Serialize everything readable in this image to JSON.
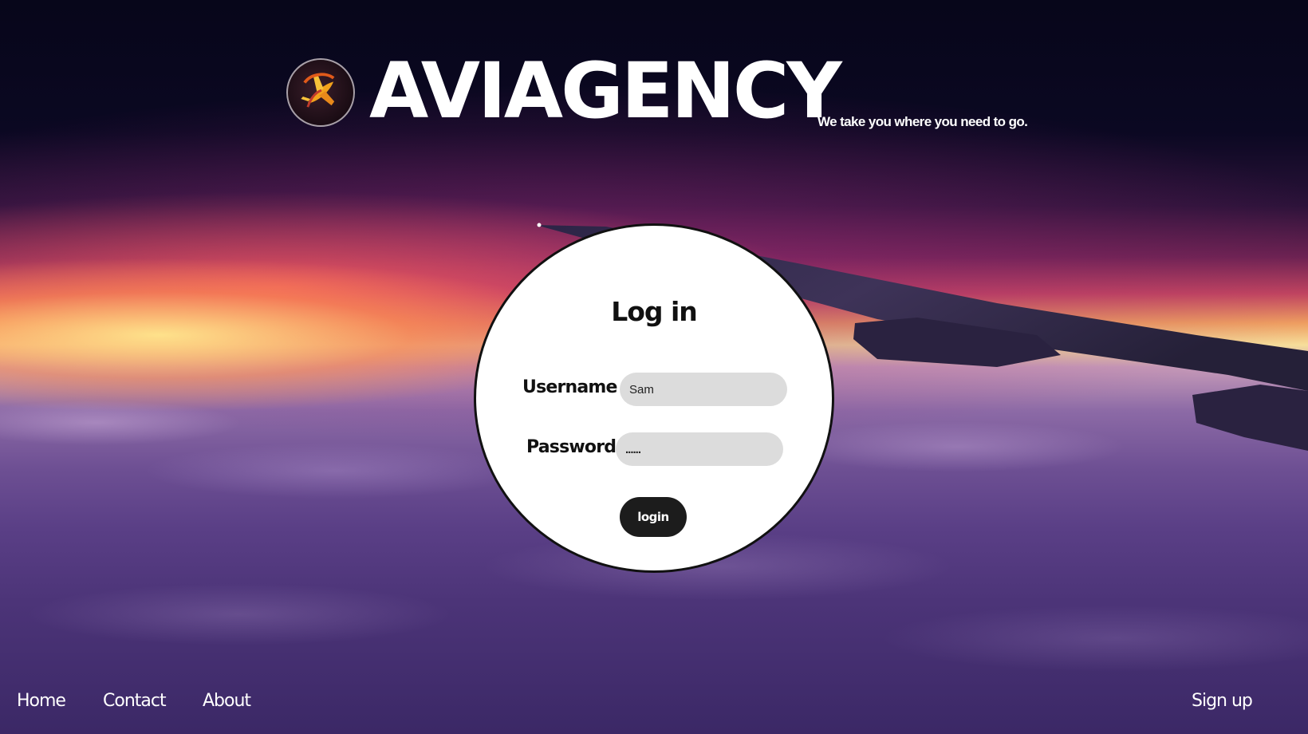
{
  "brand": {
    "logo_icon": "plane-logo-icon",
    "name": "AVIAGENCY",
    "tagline": "We take you where you need to go."
  },
  "login": {
    "title": "Log in",
    "username_label": "Username :",
    "username_value": "Sam",
    "password_label": "Password :",
    "password_value": "......",
    "button_label": "login"
  },
  "nav": {
    "home": "Home",
    "contact": "Contact",
    "about": "About",
    "signup": "Sign up"
  }
}
